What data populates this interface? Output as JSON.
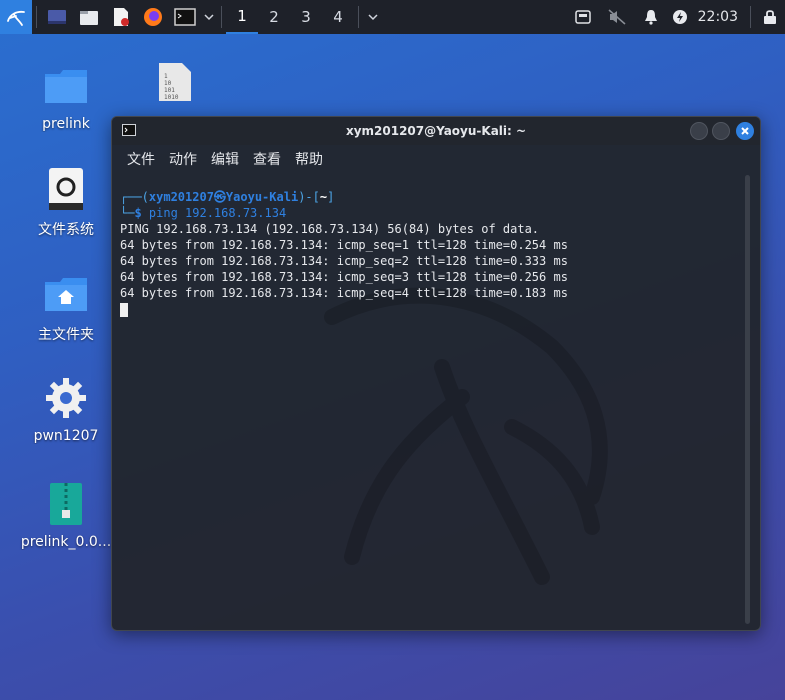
{
  "taskbar": {
    "workspaces": [
      "1",
      "2",
      "3",
      "4"
    ],
    "clock": "22:03",
    "colors": {
      "bg": "#1e2129",
      "accent": "#2f80e0"
    }
  },
  "desktop": {
    "icons": [
      {
        "label": "prelink",
        "icon": "folder-icon"
      },
      {
        "label": "文件系统",
        "icon": "drive-icon"
      },
      {
        "label": "主文件夹",
        "icon": "home-folder-icon"
      },
      {
        "label": "pwn1207",
        "icon": "gear-file-icon"
      },
      {
        "label": "prelink_0.0...",
        "icon": "archive-icon"
      }
    ]
  },
  "terminal": {
    "title": "xym201207@Yaoyu-Kali: ~",
    "menu": [
      "文件",
      "动作",
      "编辑",
      "查看",
      "帮助"
    ],
    "prompt_user": "xym201207㉿Yaoyu-Kali",
    "prompt_path": "~",
    "command": "ping 192.168.73.134",
    "output": [
      "PING 192.168.73.134 (192.168.73.134) 56(84) bytes of data.",
      "64 bytes from 192.168.73.134: icmp_seq=1 ttl=128 time=0.254 ms",
      "64 bytes from 192.168.73.134: icmp_seq=2 ttl=128 time=0.333 ms",
      "64 bytes from 192.168.73.134: icmp_seq=3 ttl=128 time=0.256 ms",
      "64 bytes from 192.168.73.134: icmp_seq=4 ttl=128 time=0.183 ms"
    ]
  }
}
